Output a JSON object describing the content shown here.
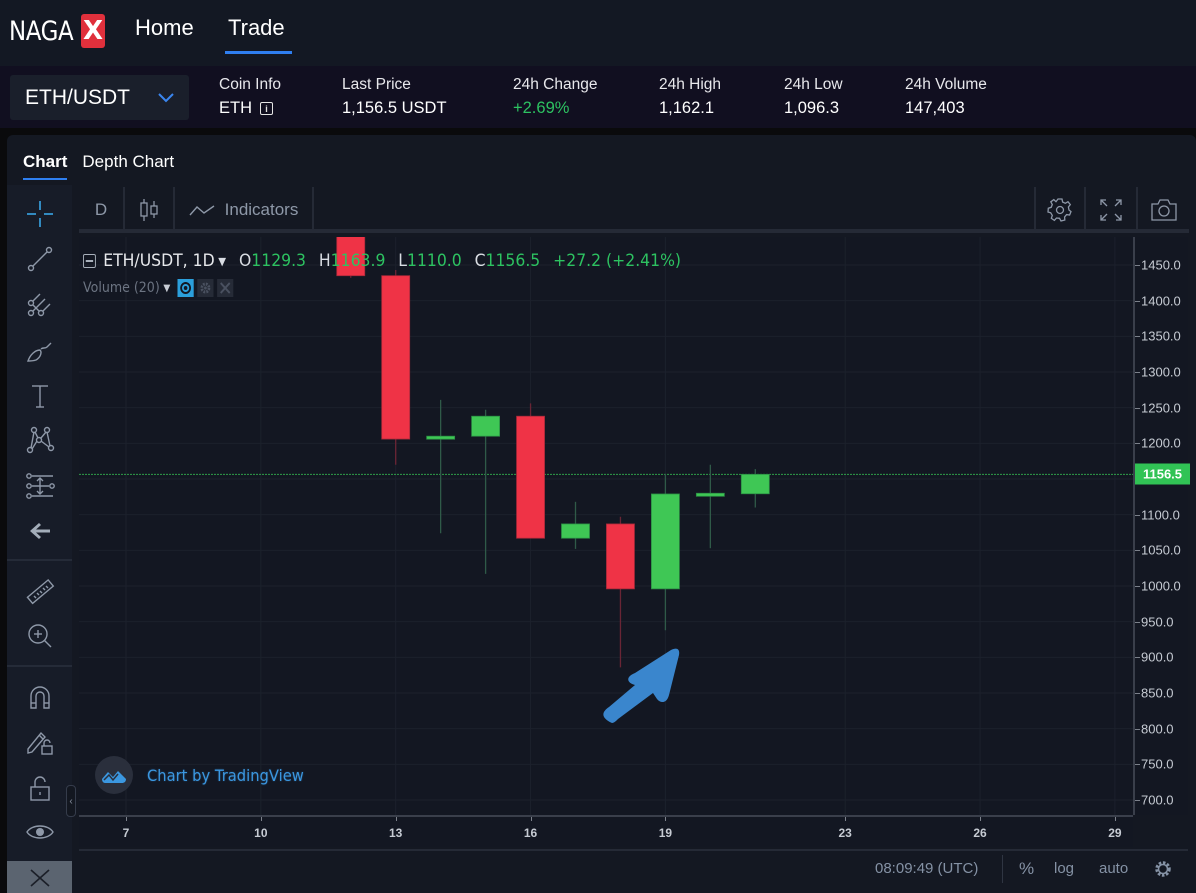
{
  "topnav": {
    "logo_text": "NAGA",
    "logo_badge": "X",
    "items": [
      {
        "label": "Home",
        "active": false
      },
      {
        "label": "Trade",
        "active": true
      }
    ]
  },
  "infobar": {
    "pair": "ETH/USDT",
    "stats": [
      {
        "label": "Coin Info",
        "value": "ETH",
        "icon": "info-icon"
      },
      {
        "label": "Last Price",
        "value": "1,156.5 USDT"
      },
      {
        "label": "24h Change",
        "value": "+2.69%",
        "positive": true
      },
      {
        "label": "24h High",
        "value": "1,162.1"
      },
      {
        "label": "24h Low",
        "value": "1,096.3"
      },
      {
        "label": "24h Volume",
        "value": "147,403"
      }
    ]
  },
  "tabs": [
    {
      "label": "Chart",
      "active": true
    },
    {
      "label": "Depth Chart",
      "active": false
    }
  ],
  "toolbar": {
    "interval": "D",
    "chart_type_icon": "candlestick-icon",
    "indicators_label": "Indicators",
    "right_icons": [
      "settings-icon",
      "fullscreen-icon",
      "camera-icon"
    ]
  },
  "left_tools": [
    "crosshair-icon",
    "trend-line-icon",
    "pitchfork-icon",
    "brush-icon",
    "text-icon",
    "pattern-icon",
    "prediction-icon",
    "back-arrow-icon",
    "ruler-icon",
    "zoom-in-icon",
    "magnet-icon",
    "lock-drawing-icon",
    "unlock-icon",
    "eye-icon",
    "close-icon"
  ],
  "legend": {
    "symbol": "ETH/USDT, 1D",
    "o_label": "O",
    "o": "1129.3",
    "h_label": "H",
    "h": "1163.9",
    "l_label": "L",
    "l": "1110.0",
    "c_label": "C",
    "c": "1156.5",
    "change": "+27.2 (+2.41%)",
    "volume_label": "Volume (20)"
  },
  "watermark": "Chart by TradingView",
  "bottom_bar": {
    "time": "08:09:49 (UTC)",
    "percent": "%",
    "log": "log",
    "auto": "auto"
  },
  "colors": {
    "up": "#3fc755",
    "down": "#ef3346",
    "accent": "#2f7ff0",
    "last_price": "#31c355"
  },
  "chart_data": {
    "type": "candlestick",
    "title": "ETH/USDT, 1D",
    "last_price": 1156.5,
    "ylim": [
      660,
      1490
    ],
    "xlim": [
      5.8,
      30
    ],
    "y_ticks": [
      1450,
      1400,
      1350,
      1300,
      1250,
      1200,
      1100,
      1050,
      1000,
      950,
      900,
      850,
      800,
      750,
      700
    ],
    "y_tick_labels": [
      "1450.0",
      "1400.0",
      "1350.0",
      "1300.0",
      "1250.0",
      "1200.0",
      "1100.0",
      "1050.0",
      "1000.0",
      "950.0",
      "900.0",
      "850.0",
      "800.0",
      "750.0",
      "700.0"
    ],
    "last_price_label": "1156.5",
    "x_ticks": [
      7,
      10,
      13,
      16,
      19,
      23,
      26,
      29
    ],
    "x_tick_labels": [
      "7",
      "10",
      "13",
      "16",
      "19",
      "23",
      "26",
      "29"
    ],
    "candles": [
      {
        "day": 12,
        "open": 1495,
        "high": 1500,
        "low": 1432,
        "close": 1435
      },
      {
        "day": 13,
        "open": 1435,
        "high": 1443,
        "low": 1170,
        "close": 1206
      },
      {
        "day": 14,
        "open": 1207,
        "high": 1261,
        "low": 1074,
        "close": 1210
      },
      {
        "day": 15,
        "open": 1210,
        "high": 1247,
        "low": 1017,
        "close": 1238
      },
      {
        "day": 16,
        "open": 1238,
        "high": 1256,
        "low": 1067,
        "close": 1067
      },
      {
        "day": 17,
        "open": 1067,
        "high": 1118,
        "low": 1052,
        "close": 1087
      },
      {
        "day": 18,
        "open": 1087,
        "high": 1097,
        "low": 886,
        "close": 996
      },
      {
        "day": 19,
        "open": 996,
        "high": 1157,
        "low": 938,
        "close": 1129
      },
      {
        "day": 20,
        "open": 1129,
        "high": 1170,
        "low": 1053,
        "close": 1130
      },
      {
        "day": 21,
        "open": 1129.3,
        "high": 1163.9,
        "low": 1110.0,
        "close": 1156.5
      }
    ],
    "annotation": "blue arrow pointing to day 18 low wick"
  }
}
